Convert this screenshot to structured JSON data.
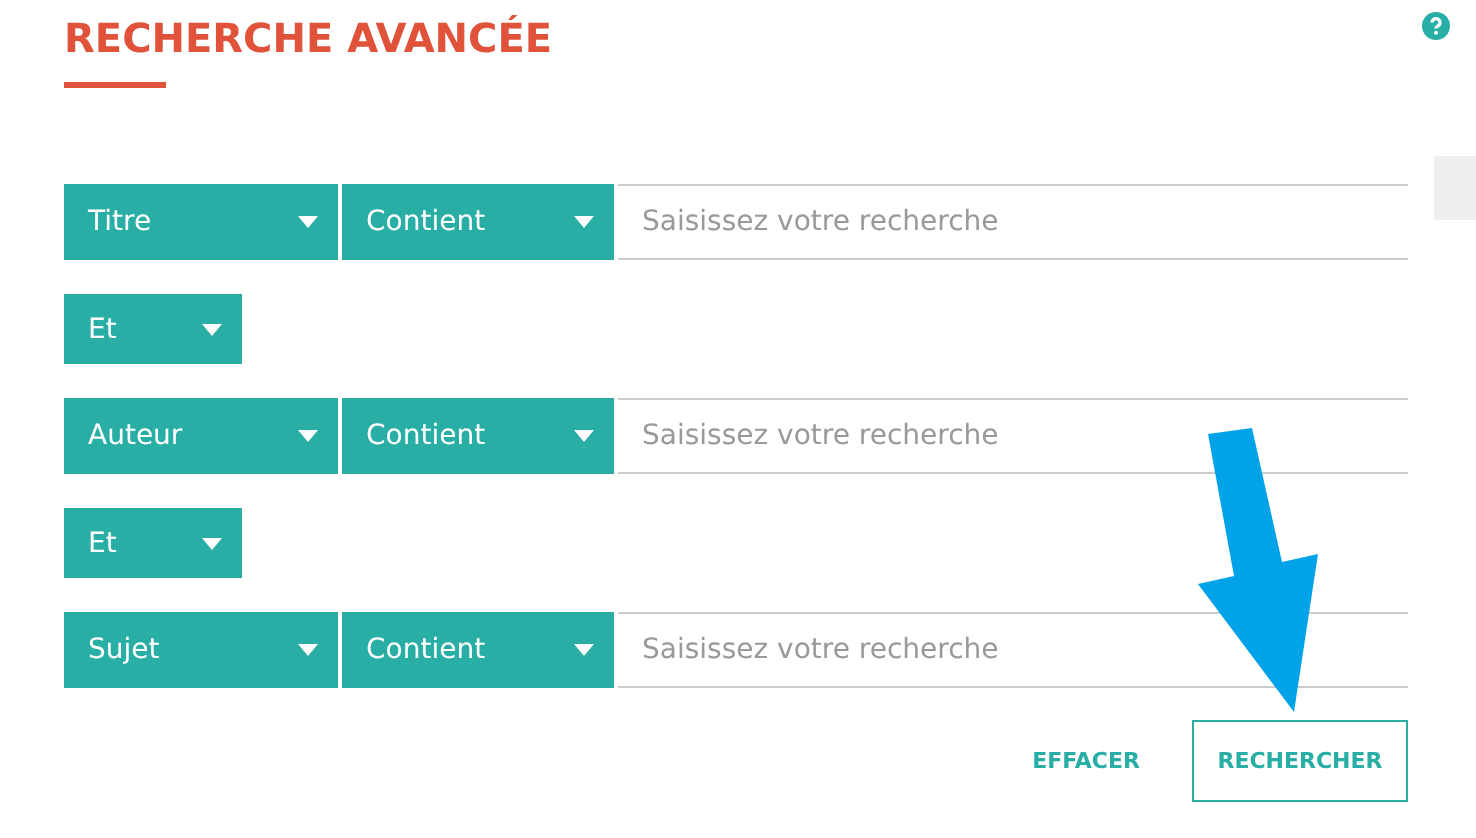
{
  "title": "RECHERCHE AVANCÉE",
  "criteria": [
    {
      "kind": "row",
      "field": "Titre",
      "condition": "Contient",
      "placeholder": "Saisissez votre recherche"
    },
    {
      "kind": "operator",
      "operator": "Et"
    },
    {
      "kind": "row",
      "field": "Auteur",
      "condition": "Contient",
      "placeholder": "Saisissez votre recherche"
    },
    {
      "kind": "operator",
      "operator": "Et"
    },
    {
      "kind": "row",
      "field": "Sujet",
      "condition": "Contient",
      "placeholder": "Saisissez votre recherche"
    }
  ],
  "buttons": [
    {
      "label": "EFFACER",
      "kind": "text"
    },
    {
      "label": "RECHERCHER",
      "kind": "outlined"
    }
  ]
}
